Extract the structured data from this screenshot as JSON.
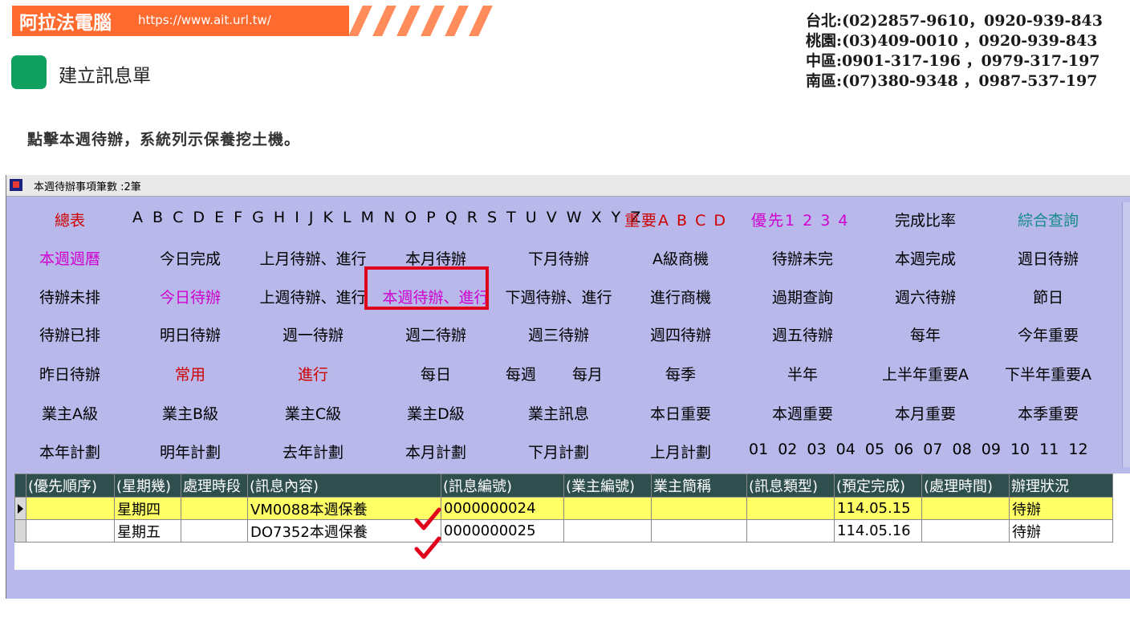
{
  "header": {
    "brand": "阿拉法電腦",
    "url": "https://www.ait.url.tw/",
    "contacts": [
      "台北:(02)2857-9610，0920-939-843",
      "桃園:(03)409-0010 ，0920-939-843",
      "中區:0901-317-196 ，0979-317-197",
      "南區:(07)380-9348 ，0987-537-197"
    ],
    "subtitle": "建立訊息單",
    "instruction": "點擊本週待辦，系統列示保養挖土機。"
  },
  "window": {
    "title": "本週待辦事項筆數 :2筆"
  },
  "menu": {
    "row1": {
      "total": "總表",
      "letters": "A B C D E F G H I J K L M N O P Q R S T U V W X Y Z",
      "important": "重要A B C D",
      "priority": "優先1 2 3 4",
      "completion_rate": "完成比率",
      "combined_query": "綜合查詢"
    },
    "row2": [
      "本週週曆",
      "今日完成",
      "上月待辦、進行",
      "本月待辦",
      "下月待辦",
      "A級商機",
      "待辦未完",
      "本週完成",
      "週日待辦"
    ],
    "row3": [
      "待辦未排",
      "今日待辦",
      "上週待辦、進行",
      "本週待辦、進行",
      "下週待辦、進行",
      "進行商機",
      "過期查詢",
      "週六待辦",
      "節日"
    ],
    "row4": [
      "待辦已排",
      "明日待辦",
      "週一待辦",
      "週二待辦",
      "週三待辦",
      "週四待辦",
      "週五待辦",
      "每年",
      "今年重要"
    ],
    "row5": [
      "昨日待辦",
      "常用",
      "進行",
      "每日",
      "每週",
      "每月",
      "每季",
      "半年",
      "上半年重要A",
      "下半年重要A"
    ],
    "row6": [
      "業主A級",
      "業主B級",
      "業主C級",
      "業主D級",
      "業主訊息",
      "本日重要",
      "本週重要",
      "本月重要",
      "本季重要"
    ],
    "row7": [
      "本年計劃",
      "明年計劃",
      "去年計劃",
      "本月計劃",
      "下月計劃",
      "上月計劃"
    ],
    "months": "01 02 03 04 05 06 07 08 09 10 11 12"
  },
  "grid": {
    "columns": [
      "(優先順序)",
      "(星期幾)",
      "處理時段",
      "(訊息內容)",
      "(訊息編號)",
      "(業主編號)",
      "業主簡稱",
      "(訊息類型)",
      "(預定完成)",
      "(處理時間)",
      "辦理狀況"
    ],
    "rows": [
      [
        "",
        "星期四",
        "",
        "VM0088本週保養",
        "0000000024",
        "",
        "",
        "",
        "114.05.15",
        "",
        "待辦"
      ],
      [
        "",
        "星期五",
        "",
        "DO7352本週保養",
        "0000000025",
        "",
        "",
        "",
        "114.05.16",
        "",
        "待辦"
      ]
    ]
  },
  "colors": {
    "banner": "#ff6b2e",
    "app_bg": "#b8b8ea",
    "header_bg": "#2f4f4f",
    "selected_row": "#ffff66",
    "highlight_box": "#e0001b",
    "checkmark": "#e0001b"
  }
}
